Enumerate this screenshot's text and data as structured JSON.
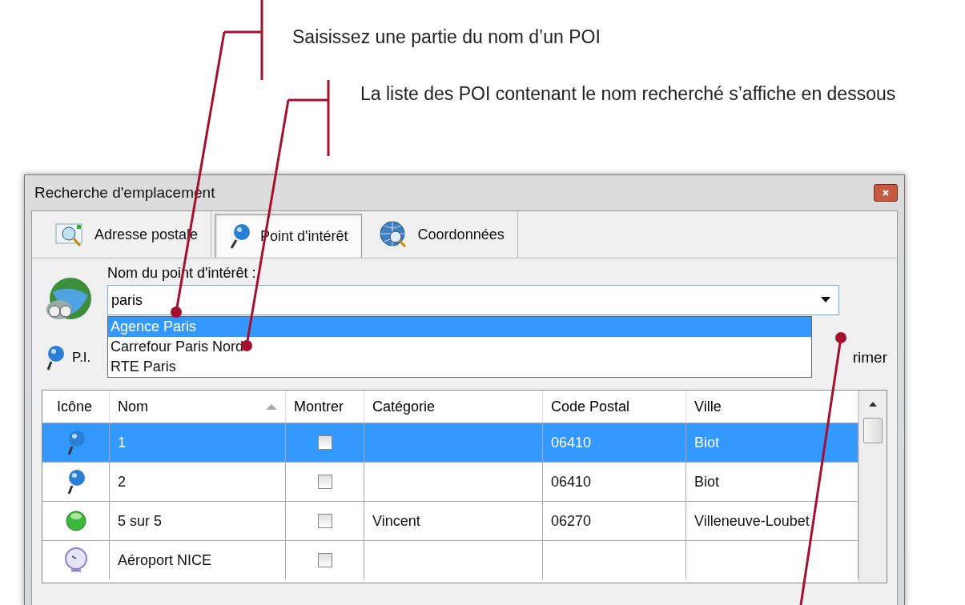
{
  "callouts": [
    {
      "text": "Saisissez une partie du nom d’un POI"
    },
    {
      "text": "La liste des POI contenant le nom recherché s’affiche en dessous"
    }
  ],
  "window": {
    "title": "Recherche d'emplacement"
  },
  "tabs": [
    {
      "label": "Adresse postale",
      "kind": "address",
      "selected": false
    },
    {
      "label": "Point d'intérêt",
      "kind": "pin",
      "selected": true
    },
    {
      "label": "Coordonnées",
      "kind": "globe",
      "selected": false
    }
  ],
  "poi_name": {
    "label": "Nom du point d'intérêt :",
    "value": "paris",
    "suggestions": [
      {
        "label": "Agence Paris",
        "selected": true
      },
      {
        "label": "Carrefour Paris Nord",
        "selected": false
      },
      {
        "label": "RTE Paris",
        "selected": false
      }
    ]
  },
  "pi_label": "P.I.",
  "button_fragment": "rimer",
  "table": {
    "columns": [
      "Icône",
      "Nom",
      "Montrer",
      "Catégorie",
      "Code Postal",
      "Ville"
    ],
    "rows": [
      {
        "kind": "pin",
        "name": "1",
        "checked": false,
        "postal_code": "06410",
        "city": "Biot",
        "selected": true
      },
      {
        "kind": "pin",
        "name": "2",
        "checked": false,
        "postal_code": "06410",
        "city": "Biot",
        "selected": false
      },
      {
        "kind": "dot",
        "name": "5 sur 5",
        "checked": false,
        "category": "Vincent",
        "postal_code": "06270",
        "city": "Villeneuve-Loubet",
        "selected": false
      },
      {
        "kind": "clock",
        "name": "Aéroport NICE",
        "checked": false,
        "selected": false
      }
    ]
  }
}
